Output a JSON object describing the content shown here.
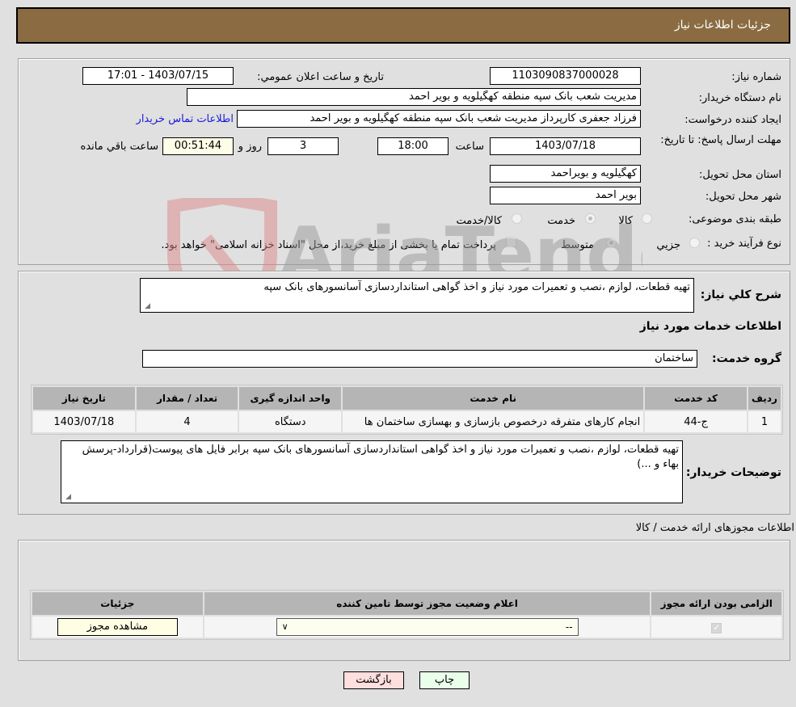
{
  "header": {
    "title": "جزئیات اطلاعات نیاز"
  },
  "form": {
    "need_number_label": "شماره نیاز:",
    "need_number": "1103090837000028",
    "announce_label": "تاریخ و ساعت اعلان عمومي:",
    "announce_value": "1403/07/15 - 17:01",
    "buyer_org_label": "نام دستگاه خریدار:",
    "buyer_org": "مدیریت شعب بانک سپه منطقه کهگیلویه و بویر احمد",
    "creator_label": "ایجاد کننده درخواست:",
    "creator": "فرزاد جعفری کارپرداز مدیریت شعب بانک سپه منطقه کهگیلویه و بویر احمد",
    "contact_link": "اطلاعات تماس خریدار",
    "deadline_label": "مهلت ارسال پاسخ: تا تاریخ:",
    "deadline_date": "1403/07/18",
    "time_label": "ساعت",
    "deadline_time": "18:00",
    "days_value": "3",
    "days_label": "روز و",
    "remaining_value": "00:51:44",
    "remaining_label": "ساعت باقي مانده",
    "province_label": "استان محل تحویل:",
    "province": "کهگیلویه و بویراحمد",
    "city_label": "شهر محل تحویل:",
    "city": "بویر احمد",
    "category_label": "طبقه بندی موضوعی:",
    "category_options": [
      {
        "label": "کالا",
        "checked": false
      },
      {
        "label": "خدمت",
        "checked": true
      },
      {
        "label": "کالا/خدمت",
        "checked": false
      }
    ],
    "process_label": "نوع فرآیند خرید :",
    "process_options": [
      {
        "label": "جزيي",
        "checked": false
      },
      {
        "label": "متوسط",
        "checked": true
      }
    ],
    "treasury_note": "پرداخت تمام یا بخشی از مبلغ خرید،از محل \"اسناد خزانه اسلامی\" خواهد بود."
  },
  "summary": {
    "label": "شرح کلي نیاز:",
    "text": "تهیه قطعات، لوازم ،نصب و تعمیرات مورد نیاز و اخذ گواهی استانداردسازی آسانسورهای بانک سپه",
    "services_heading": "اطلاعات خدمات مورد نیاز",
    "service_group_label": "گروه خدمت:",
    "service_group": "ساختمان"
  },
  "services_table": {
    "headers": [
      "ردیف",
      "کد خدمت",
      "نام خدمت",
      "واحد اندازه گیری",
      "تعداد / مقدار",
      "تاریخ نیاز"
    ],
    "rows": [
      [
        "1",
        "ج-44",
        "انجام کارهای متفرقه درخصوص بازسازی و بهسازی ساختمان ها",
        "دستگاه",
        "4",
        "1403/07/18"
      ]
    ]
  },
  "buyer_notes": {
    "label": "توضیحات خریدار:",
    "text": "تهیه قطعات، لوازم ،نصب و تعمیرات مورد نیاز و اخذ گواهی استانداردسازی آسانسورهای بانک سپه برابر فایل های پیوست(قرارداد-پرسش بهاء و ...)"
  },
  "permits": {
    "heading": "اطلاعات مجوزهای ارائه خدمت / کالا",
    "headers": [
      "الزامی بودن ارائه مجوز",
      "اعلام وضعیت مجوز توسط تامین کننده",
      "جزئیات"
    ],
    "row": {
      "required_checked": true,
      "status_value": "--",
      "view_button": "مشاهده مجوز"
    }
  },
  "actions": {
    "print": "چاپ",
    "back": "بازگشت"
  },
  "watermark": {
    "text": "AriaTender.net"
  },
  "colors": {
    "header_bg": "#8b6c42",
    "print_bg": "#eaffea",
    "back_bg": "#ffdede",
    "link": "#1a1adc"
  }
}
